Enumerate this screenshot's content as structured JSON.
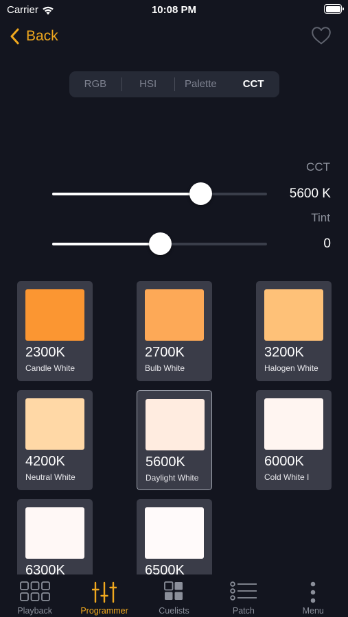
{
  "status_bar": {
    "carrier": "Carrier",
    "time": "10:08 PM"
  },
  "nav": {
    "back_label": "Back"
  },
  "segments": [
    "RGB",
    "HSI",
    "Palette",
    "CCT"
  ],
  "active_segment": "CCT",
  "sliders": {
    "cct": {
      "label": "CCT",
      "value": "5600 K",
      "level": 0.69
    },
    "tint": {
      "label": "Tint",
      "value": "0",
      "level": 0.5
    }
  },
  "presets": [
    {
      "kelvin": "2300K",
      "name": "Candle White",
      "color": "#fb9632"
    },
    {
      "kelvin": "2700K",
      "name": "Bulb White",
      "color": "#fda957"
    },
    {
      "kelvin": "3200K",
      "name": "Halogen White",
      "color": "#fec178"
    },
    {
      "kelvin": "4200K",
      "name": "Neutral White",
      "color": "#ffd8a6"
    },
    {
      "kelvin": "5600K",
      "name": "Daylight White",
      "color": "#ffece0"
    },
    {
      "kelvin": "6000K",
      "name": "Cold White I",
      "color": "#fff5f1"
    },
    {
      "kelvin": "6300K",
      "name": "",
      "color": "#fff8f6"
    },
    {
      "kelvin": "6500K",
      "name": "",
      "color": "#fffafa"
    }
  ],
  "selected_preset": "5600K",
  "tabbar": {
    "items": [
      "Playback",
      "Programmer",
      "Cuelists",
      "Patch",
      "Menu"
    ],
    "active": "Programmer"
  },
  "colors": {
    "accent": "#f0a81e",
    "background": "#13151f",
    "card": "#3a3c48"
  }
}
